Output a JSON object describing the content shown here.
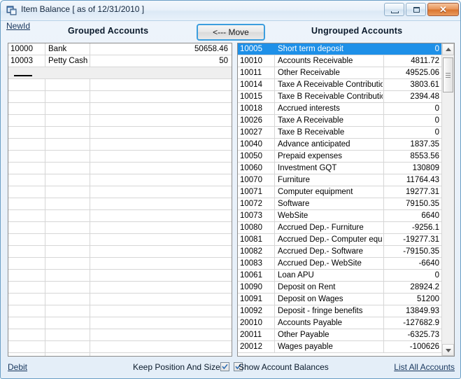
{
  "window": {
    "title": "Item Balance [ as of 12/31/2010 ]",
    "icon_name": "app-form-icon",
    "minimize_label": "–",
    "maximize_label": "□",
    "close_label": "✕"
  },
  "toolbar": {
    "newid_label": "NewId",
    "grouped_header": "Grouped Accounts",
    "ungrouped_header": "Ungrouped Accounts",
    "move_label": "<--- Move"
  },
  "grouped_accounts": {
    "rows": [
      {
        "id": "10000",
        "name": "Bank",
        "value": "50658.46"
      },
      {
        "id": "10003",
        "name": "Petty Cash",
        "value": "50"
      }
    ],
    "new_row_placeholder": ""
  },
  "ungrouped_accounts": {
    "selected_index": 0,
    "rows": [
      {
        "id": "10005",
        "name": "Short term deposit",
        "value": "0"
      },
      {
        "id": "10010",
        "name": "Accounts Receivable",
        "value": "4811.72"
      },
      {
        "id": "10011",
        "name": "Other Receivable",
        "value": "49525.06"
      },
      {
        "id": "10014",
        "name": "Taxe A Receivable Contribution",
        "value": "3803.61"
      },
      {
        "id": "10015",
        "name": "Taxe B Receivable Contribution",
        "value": "2394.48"
      },
      {
        "id": "10018",
        "name": "Accrued interests",
        "value": "0"
      },
      {
        "id": "10026",
        "name": "Taxe A Receivable",
        "value": "0"
      },
      {
        "id": "10027",
        "name": "Taxe B Receivable",
        "value": "0"
      },
      {
        "id": "10040",
        "name": "Advance anticipated",
        "value": "1837.35"
      },
      {
        "id": "10050",
        "name": "Prepaid expenses",
        "value": "8553.56"
      },
      {
        "id": "10060",
        "name": "Investment GQT",
        "value": "130809"
      },
      {
        "id": "10070",
        "name": "Furniture",
        "value": "11764.43"
      },
      {
        "id": "10071",
        "name": "Computer equipment",
        "value": "19277.31"
      },
      {
        "id": "10072",
        "name": "Software",
        "value": "79150.35"
      },
      {
        "id": "10073",
        "name": "WebSite",
        "value": "6640"
      },
      {
        "id": "10080",
        "name": "Accrued Dep.- Furniture",
        "value": "-9256.1"
      },
      {
        "id": "10081",
        "name": "Accrued Dep.- Computer equip.",
        "value": "-19277.31"
      },
      {
        "id": "10082",
        "name": "Accrued Dep.- Software",
        "value": "-79150.35"
      },
      {
        "id": "10083",
        "name": "Accrued Dep.- WebSite",
        "value": "-6640"
      },
      {
        "id": "10061",
        "name": "Loan APU",
        "value": "0"
      },
      {
        "id": "10090",
        "name": "Deposit on Rent",
        "value": "28924.2"
      },
      {
        "id": "10091",
        "name": "Deposit on Wages",
        "value": "51200"
      },
      {
        "id": "10092",
        "name": "Deposit - fringe benefits",
        "value": "13849.93"
      },
      {
        "id": "20010",
        "name": "Accounts Payable",
        "value": "-127682.9"
      },
      {
        "id": "20011",
        "name": "Other Payable",
        "value": "-6325.73"
      },
      {
        "id": "20012",
        "name": "Wages payable",
        "value": "-100626"
      }
    ]
  },
  "statusbar": {
    "debit_label": "Debit",
    "keep_position_label": "Keep Position And Size",
    "keep_position_checked": true,
    "show_balances_label": "Show Account Balances",
    "show_balances_checked": true,
    "list_all_label": "List All Accounts"
  },
  "colors": {
    "selection_blue": "#1e90e8",
    "focus_border": "#3c9ede",
    "window_border": "#6b9fc6",
    "link": "#17365d"
  }
}
